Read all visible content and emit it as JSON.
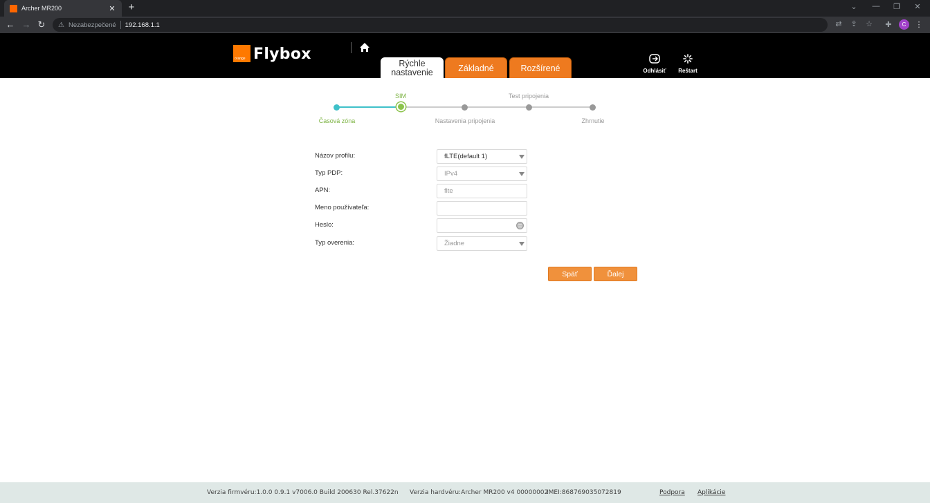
{
  "browser": {
    "tab_title": "Archer MR200",
    "tab_close": "✕",
    "new_tab": "+",
    "security_label": "Nezabezpečené",
    "url": "192.168.1.1",
    "profile_initial": "C"
  },
  "header": {
    "brand": "Flybox",
    "logo_text": "orange",
    "tabs": [
      {
        "label_line1": "Rýchle",
        "label_line2": "nastavenie",
        "active": true
      },
      {
        "label": "Základné"
      },
      {
        "label": "Rozšírené"
      }
    ],
    "logout_label": "Odhlásiť",
    "restart_label": "Reštart",
    "accent_color": "#ee7a1f"
  },
  "stepper": {
    "steps": [
      {
        "label": "Časová zóna",
        "state": "done"
      },
      {
        "label": "SIM",
        "state": "current"
      },
      {
        "label": "Nastavenia pripojenia",
        "state": "pending"
      },
      {
        "label": "Test pripojenia",
        "state": "pending"
      },
      {
        "label": "Zhrnutie",
        "state": "pending"
      }
    ]
  },
  "form": {
    "profile_name_label": "Názov profilu:",
    "profile_name_value": "fLTE(default 1)",
    "pdp_type_label": "Typ PDP:",
    "pdp_type_value": "IPv4",
    "apn_label": "APN:",
    "apn_value": "flte",
    "username_label": "Meno používateľa:",
    "username_value": "",
    "password_label": "Heslo:",
    "password_value": "",
    "auth_type_label": "Typ overenia:",
    "auth_type_value": "Žiadne"
  },
  "buttons": {
    "back": "Späť",
    "next": "Ďalej"
  },
  "footer": {
    "firmware": "Verzia firmvéru:1.0.0 0.9.1 v7006.0 Build 200630 Rel.37622n",
    "hardware": "Verzia hardvéru:Archer MR200 v4 00000002",
    "imei": "IMEI:868769035072819",
    "support_link": "Podpora",
    "apps_link": "Aplikácie"
  }
}
